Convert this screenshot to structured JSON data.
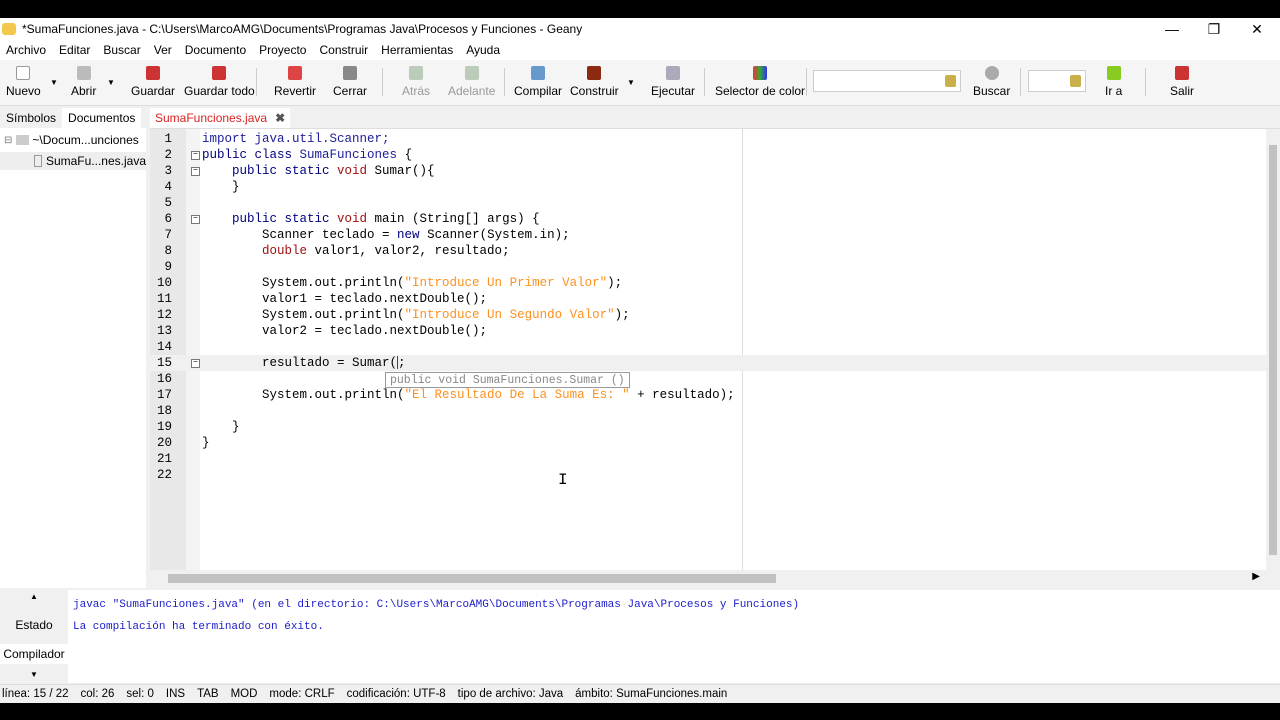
{
  "window": {
    "title": "*SumaFunciones.java - C:\\Users\\MarcoAMG\\Documents\\Programas Java\\Procesos y Funciones - Geany"
  },
  "menu": [
    "Archivo",
    "Editar",
    "Buscar",
    "Ver",
    "Documento",
    "Proyecto",
    "Construir",
    "Herramientas",
    "Ayuda"
  ],
  "toolbar": {
    "nuevo": "Nuevo",
    "abrir": "Abrir",
    "guardar": "Guardar",
    "guardar_todo": "Guardar todo",
    "revertir": "Revertir",
    "cerrar": "Cerrar",
    "atras": "Atrás",
    "adelante": "Adelante",
    "compilar": "Compilar",
    "construir": "Construir",
    "ejecutar": "Ejecutar",
    "selector": "Selector de color",
    "buscar": "Buscar",
    "ir_a": "Ir a",
    "salir": "Salir"
  },
  "sidebar": {
    "tabs": [
      "Símbolos",
      "Documentos"
    ],
    "folder": "~\\Docum...unciones",
    "file": "SumaFu...nes.java"
  },
  "editor_tab": "SumaFunciones.java",
  "code": [
    [
      [
        "import java.util.Scanner;",
        "c"
      ]
    ],
    [
      [
        "public class ",
        "k"
      ],
      [
        "SumaFunciones",
        "c"
      ],
      [
        " {",
        "p"
      ]
    ],
    [
      [
        "    public static ",
        "k"
      ],
      [
        "void",
        "t"
      ],
      [
        " Sumar(){",
        "p"
      ]
    ],
    [
      [
        "    }",
        "p"
      ]
    ],
    [
      [
        "",
        "p"
      ]
    ],
    [
      [
        "    public static ",
        "k"
      ],
      [
        "void",
        "t"
      ],
      [
        " main (String[] args) {",
        "p"
      ]
    ],
    [
      [
        "        Scanner teclado = ",
        "p"
      ],
      [
        "new",
        "k"
      ],
      [
        " Scanner(System.in);",
        "p"
      ]
    ],
    [
      [
        "        ",
        "p"
      ],
      [
        "double",
        "t"
      ],
      [
        " valor1, valor2, resultado;",
        "p"
      ]
    ],
    [
      [
        "",
        "p"
      ]
    ],
    [
      [
        "        System.out.println(",
        "p"
      ],
      [
        "\"Introduce Un Primer Valor\"",
        "s"
      ],
      [
        ");",
        "p"
      ]
    ],
    [
      [
        "        valor1 = teclado.nextDouble();",
        "p"
      ]
    ],
    [
      [
        "        System.out.println(",
        "p"
      ],
      [
        "\"Introduce Un Segundo Valor\"",
        "s"
      ],
      [
        ");",
        "p"
      ]
    ],
    [
      [
        "        valor2 = teclado.nextDouble();",
        "p"
      ]
    ],
    [
      [
        "",
        "p"
      ]
    ],
    [
      [
        "        resultado = Sumar(",
        "p"
      ],
      [
        ";",
        "p"
      ]
    ],
    [
      [
        "",
        "p"
      ]
    ],
    [
      [
        "        System.out.println(",
        "p"
      ],
      [
        "\"El Resultado De La Suma Es: \"",
        "s"
      ],
      [
        " + resultado);",
        "p"
      ]
    ],
    [
      [
        "",
        "p"
      ]
    ],
    [
      [
        "    }",
        "p"
      ]
    ],
    [
      [
        "}",
        "p"
      ]
    ],
    [
      [
        "",
        "p"
      ]
    ],
    [
      [
        "",
        "p"
      ]
    ]
  ],
  "calltip": "public void SumaFunciones.Sumar ()",
  "messages": {
    "tabs": [
      "Estado",
      "Compilador"
    ],
    "lines": [
      "javac \"SumaFunciones.java\" (en el directorio: C:\\Users\\MarcoAMG\\Documents\\Programas Java\\Procesos y Funciones)",
      "La compilación ha terminado con éxito."
    ]
  },
  "status": [
    "línea: 15 / 22",
    "col: 26",
    "sel: 0",
    "INS",
    "TAB",
    "MOD",
    "mode: CRLF",
    "codificación: UTF-8",
    "tipo de archivo: Java",
    "ámbito: SumaFunciones.main"
  ]
}
